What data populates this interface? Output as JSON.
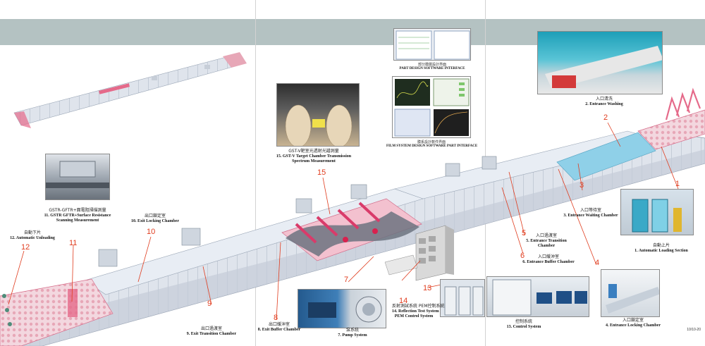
{
  "colors": {
    "header_band": "#b4c2c2",
    "pointer": "#e03c1e",
    "chamber_pink": "#e56a8a",
    "chamber_frame": "#bfc7d3",
    "window_blue": "#8fd0e8",
    "cabinet": "#d9d9d9"
  },
  "stations": [
    {
      "num": "1",
      "cn": "自動上片",
      "en": "1. Automatic Loading Section"
    },
    {
      "num": "2",
      "cn": "入口清洗",
      "en": "2. Entrance Washing"
    },
    {
      "num": "3",
      "cn": "入口等待室",
      "en": "3. Entrance Waiting Chamber"
    },
    {
      "num": "4",
      "cn": "入口鎖定室",
      "en": "4. Entrance Locking Chamber"
    },
    {
      "num": "5",
      "cn": "入口過渡室",
      "en": "5. Entrance Transition",
      "en2": "Chamber"
    },
    {
      "num": "6",
      "cn": "入口緩沖室",
      "en": "6. Entrance Buffer Chamber"
    },
    {
      "num": "7",
      "cn": "泵系統",
      "en": "7. Pump System"
    },
    {
      "num": "8",
      "cn": "出口緩沖室",
      "en": "8. Exit Buffer Chamber"
    },
    {
      "num": "9",
      "cn": "出口過渡室",
      "en": "9. Exit Transition Chamber"
    },
    {
      "num": "10",
      "cn": "出口鎖定室",
      "en": "10. Exit Locking Chamber"
    },
    {
      "num": "11",
      "cn": "GSTR-GFTR+面電阻掃描測量",
      "en": "11. GSTR GFTR+Surface Resistance",
      "en2": "Scanning Measurement"
    },
    {
      "num": "12",
      "cn": "自動下片",
      "en": "12. Automatic Unloading"
    },
    {
      "num": "13",
      "cn": "控制系統",
      "en": "13. Control System"
    },
    {
      "num": "14",
      "cn": "反射測試系統 PEM控制系統",
      "en": "14. Reflection Test System",
      "en2": "PEM Control System"
    },
    {
      "num": "15",
      "cn": "GST-V靶室光透射光譜測量",
      "en": "15. GST-V Target Chamber Transmission",
      "en2": "Spectrum Measurement"
    }
  ],
  "software": [
    {
      "cn": "部分膜層設計界面",
      "en": "PART DESIGN SOFTWARE INTERFACE"
    },
    {
      "cn": "膜系設計軟件界面",
      "en": "FILM SYSTEM DESIGN SOFTWARE PART INTERFACE"
    }
  ],
  "page_number": "10/10-20"
}
